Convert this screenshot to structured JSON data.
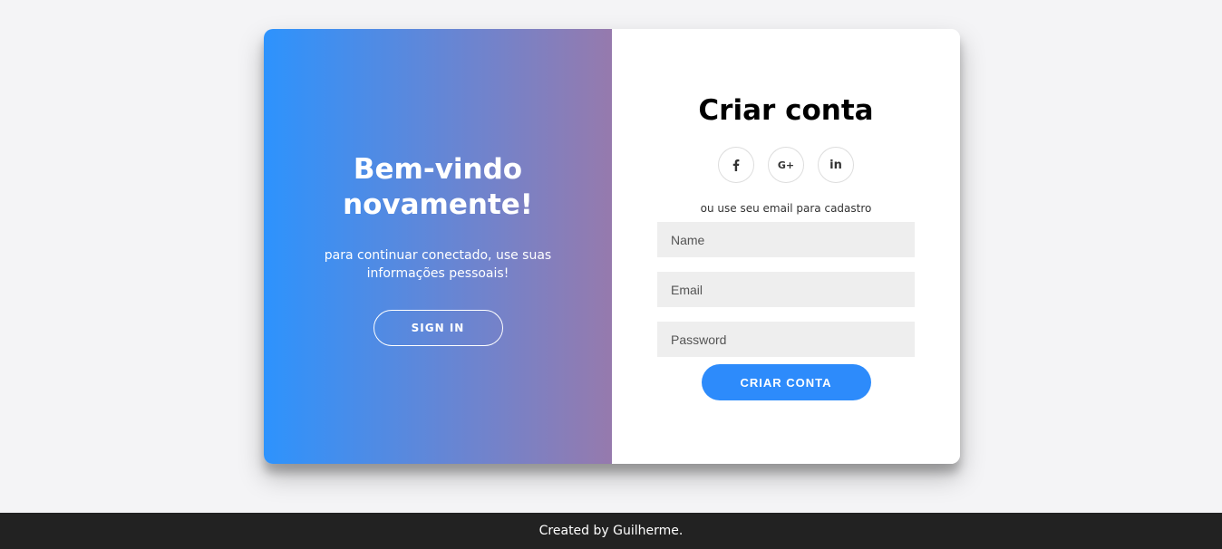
{
  "colors": {
    "page_background": "#f4f4f6",
    "gradient_start": "#2d93fd",
    "gradient_end": "#967aad",
    "primary_button": "#2d8bfb",
    "input_background": "#eeeeee",
    "footer_background": "#222222"
  },
  "welcome_panel": {
    "title_line1": "Bem-vindo",
    "title_line2": "novamente!",
    "text": "para continuar conectado, use suas informações pessoais!",
    "button_label": "SIGN IN"
  },
  "signup_form": {
    "title": "Criar conta",
    "social_buttons": [
      {
        "icon": "facebook-icon",
        "glyph": "f"
      },
      {
        "icon": "google-plus-icon",
        "glyph": "G+"
      },
      {
        "icon": "linkedin-icon",
        "glyph": "in"
      }
    ],
    "helper_text": "ou use seu email para cadastro",
    "name_placeholder": "Name",
    "email_placeholder": "Email",
    "password_placeholder": "Password",
    "submit_label": "CRIAR CONTA"
  },
  "footer": {
    "text": "Created by Guilherme."
  }
}
